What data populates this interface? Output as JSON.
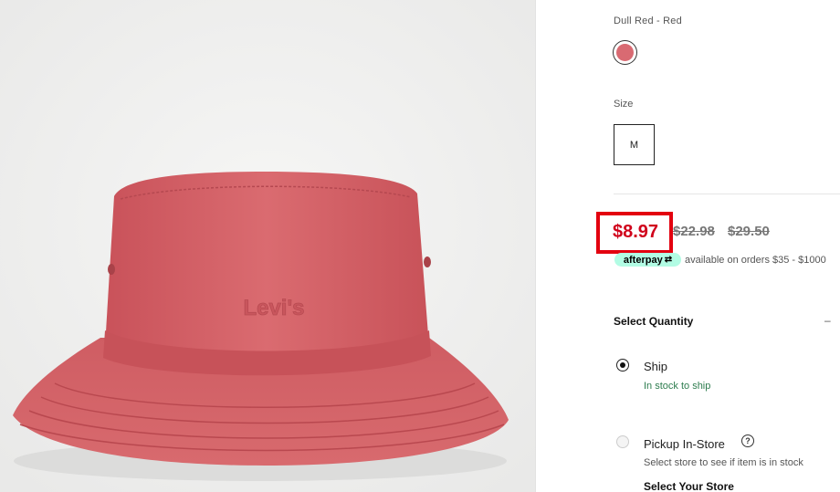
{
  "product": {
    "image_alt": "Levi's Dull Red bucket hat",
    "logo_text": "Levi's"
  },
  "color": {
    "label": "Dull Red - Red",
    "swatch_color": "#d96a72"
  },
  "size": {
    "label": "Size",
    "selected": "M"
  },
  "price": {
    "sale": "$8.97",
    "was_1": "$22.98",
    "was_2": "$29.50",
    "sale_color": "#d0021b",
    "highlight_color": "#e3000f"
  },
  "afterpay": {
    "badge": "afterpay",
    "text": "available on orders $35 - $1000"
  },
  "quantity": {
    "heading": "Select Quantity",
    "toggle_icon": "minus-icon"
  },
  "fulfillment": {
    "ship_label": "Ship",
    "ship_status": "In stock to ship",
    "pickup_label": "Pickup In-Store",
    "pickup_help": "?",
    "pickup_note": "Select store to see if item is in stock",
    "select_store": "Select Your Store"
  }
}
